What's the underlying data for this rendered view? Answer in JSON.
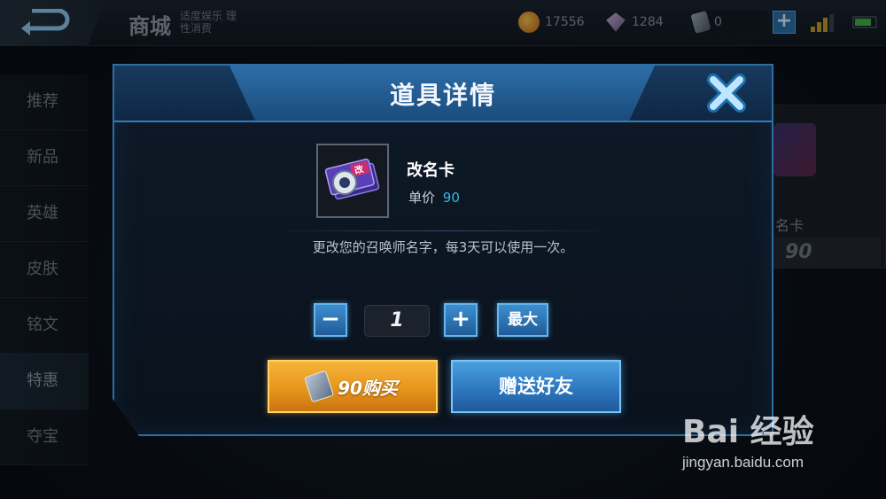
{
  "topbar": {
    "title": "商城",
    "slogan": "适度娱乐 理性消费",
    "gold": "17556",
    "diamonds": "1284",
    "coupons": "0",
    "add_label": "+"
  },
  "sidenav": {
    "items": [
      {
        "label": "推荐"
      },
      {
        "label": "新品"
      },
      {
        "label": "英雄"
      },
      {
        "label": "皮肤"
      },
      {
        "label": "铭文"
      },
      {
        "label": "特惠"
      },
      {
        "label": "夺宝"
      }
    ],
    "active_index": 5
  },
  "background_card": {
    "name": "名卡",
    "price": "90"
  },
  "modal": {
    "title": "道具详情",
    "item": {
      "name": "改名卡",
      "price_label": "单价",
      "price": "90",
      "icon_text": "改",
      "description": "更改您的召唤师名字，每3天可以使用一次。"
    },
    "quantity": {
      "minus_label": "−",
      "value": "1",
      "plus_label": "+",
      "max_label": "最大"
    },
    "buy_button": "90购买",
    "gift_button": "赠送好友"
  },
  "watermark": {
    "logo": "Bai 经验",
    "url": "jingyan.baidu.com"
  },
  "colors": {
    "accent_blue": "#2f7cc0",
    "price_blue": "#3ab6e8",
    "buy_gold": "#f6b33a"
  }
}
